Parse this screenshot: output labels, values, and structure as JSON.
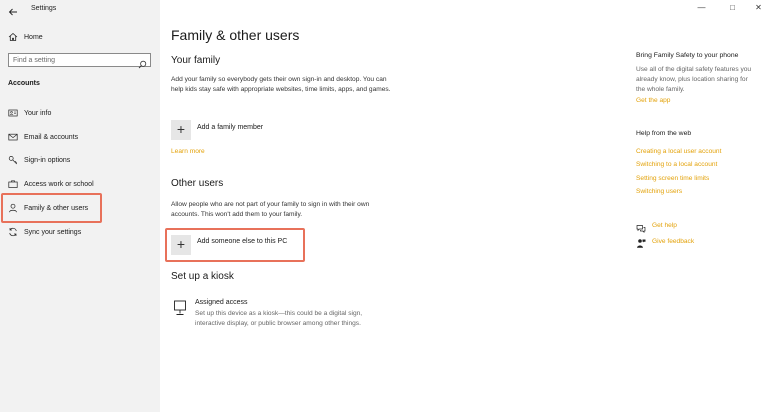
{
  "window": {
    "app_title": "Settings",
    "controls": {
      "minimize": "—",
      "maximize": "□",
      "close": "✕"
    }
  },
  "sidebar": {
    "home_label": "Home",
    "search_placeholder": "Find a setting",
    "section_label": "Accounts",
    "items": [
      {
        "label": "Your info",
        "icon": "person-card-icon"
      },
      {
        "label": "Email & accounts",
        "icon": "email-icon"
      },
      {
        "label": "Sign-in options",
        "icon": "key-icon"
      },
      {
        "label": "Access work or school",
        "icon": "briefcase-icon"
      },
      {
        "label": "Family & other users",
        "icon": "person-icon",
        "selected": true
      },
      {
        "label": "Sync your settings",
        "icon": "sync-icon"
      }
    ]
  },
  "main": {
    "page_title": "Family & other users",
    "family": {
      "heading": "Your family",
      "description": "Add your family so everybody gets their own sign-in and desktop. You can help kids stay safe with appropriate websites, time limits, apps, and games.",
      "add_label": "Add a family member",
      "learn_more": "Learn more"
    },
    "other_users": {
      "heading": "Other users",
      "description": "Allow people who are not part of your family to sign in with their own accounts. This won't add them to your family.",
      "add_label": "Add someone else to this PC"
    },
    "kiosk": {
      "heading": "Set up a kiosk",
      "item_title": "Assigned access",
      "item_description": "Set up this device as a kiosk—this could be a digital sign, interactive display, or public browser among other things."
    }
  },
  "right_panel": {
    "family_safety": {
      "heading": "Bring Family Safety to your phone",
      "description": "Use all of the digital safety features you already know, plus location sharing for the whole family.",
      "link": "Get the app"
    },
    "help": {
      "heading": "Help from the web",
      "links": [
        "Creating a local user account",
        "Switching to a local account",
        "Setting screen time limits",
        "Switching users"
      ]
    },
    "support": {
      "get_help": "Get help",
      "give_feedback": "Give feedback"
    }
  },
  "colors": {
    "accent_link": "#e3a20a",
    "highlight_box": "#e8715a",
    "sidebar_bg": "#f2f2f2"
  }
}
